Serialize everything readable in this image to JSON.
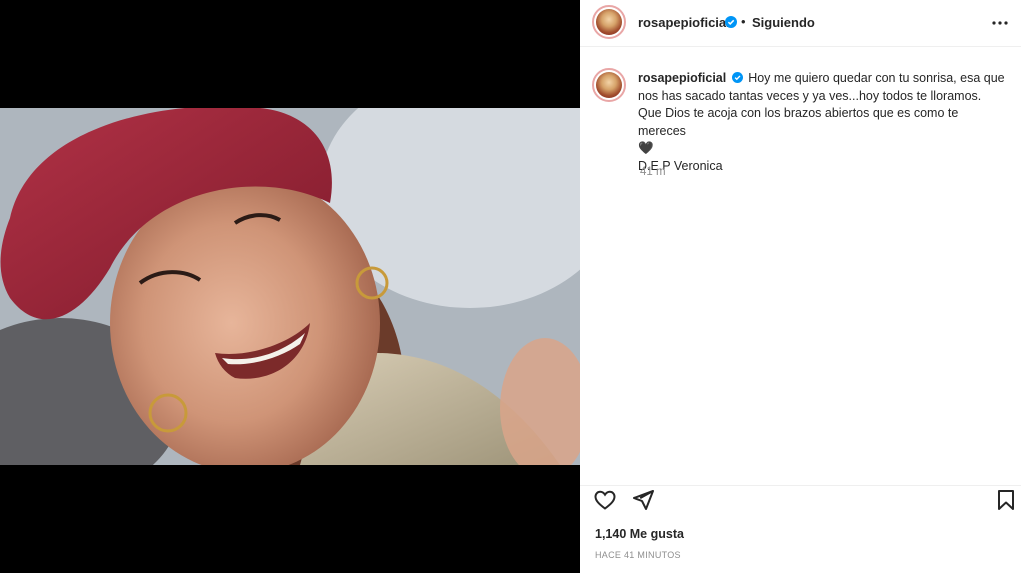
{
  "post": {
    "username": "rosapepioficial",
    "separator": "•",
    "follow_status": "Siguiendo",
    "caption": {
      "text_line1": "Hoy me quiero quedar con tu sonrisa, esa que nos has sacado tantas veces y ya ves...hoy todos te lloramos.",
      "text_line2": "Que Dios te acoja con los brazos abiertos que es como te mereces",
      "heart_emoji": "🖤",
      "text_line3": "D.E.P Veronica"
    },
    "caption_time": "41 m",
    "likes": "1,140 Me gusta",
    "posted_ago": "HACE 41 MINUTOS"
  },
  "icons": {
    "more": "more-options-icon",
    "like": "heart-icon",
    "share": "send-icon",
    "save": "bookmark-icon",
    "verified": "verified-badge-icon"
  },
  "colors": {
    "verified_blue": "#0095f6",
    "text_primary": "#262626",
    "text_secondary": "#8e8e8e",
    "beret_red": "#9b2335"
  }
}
